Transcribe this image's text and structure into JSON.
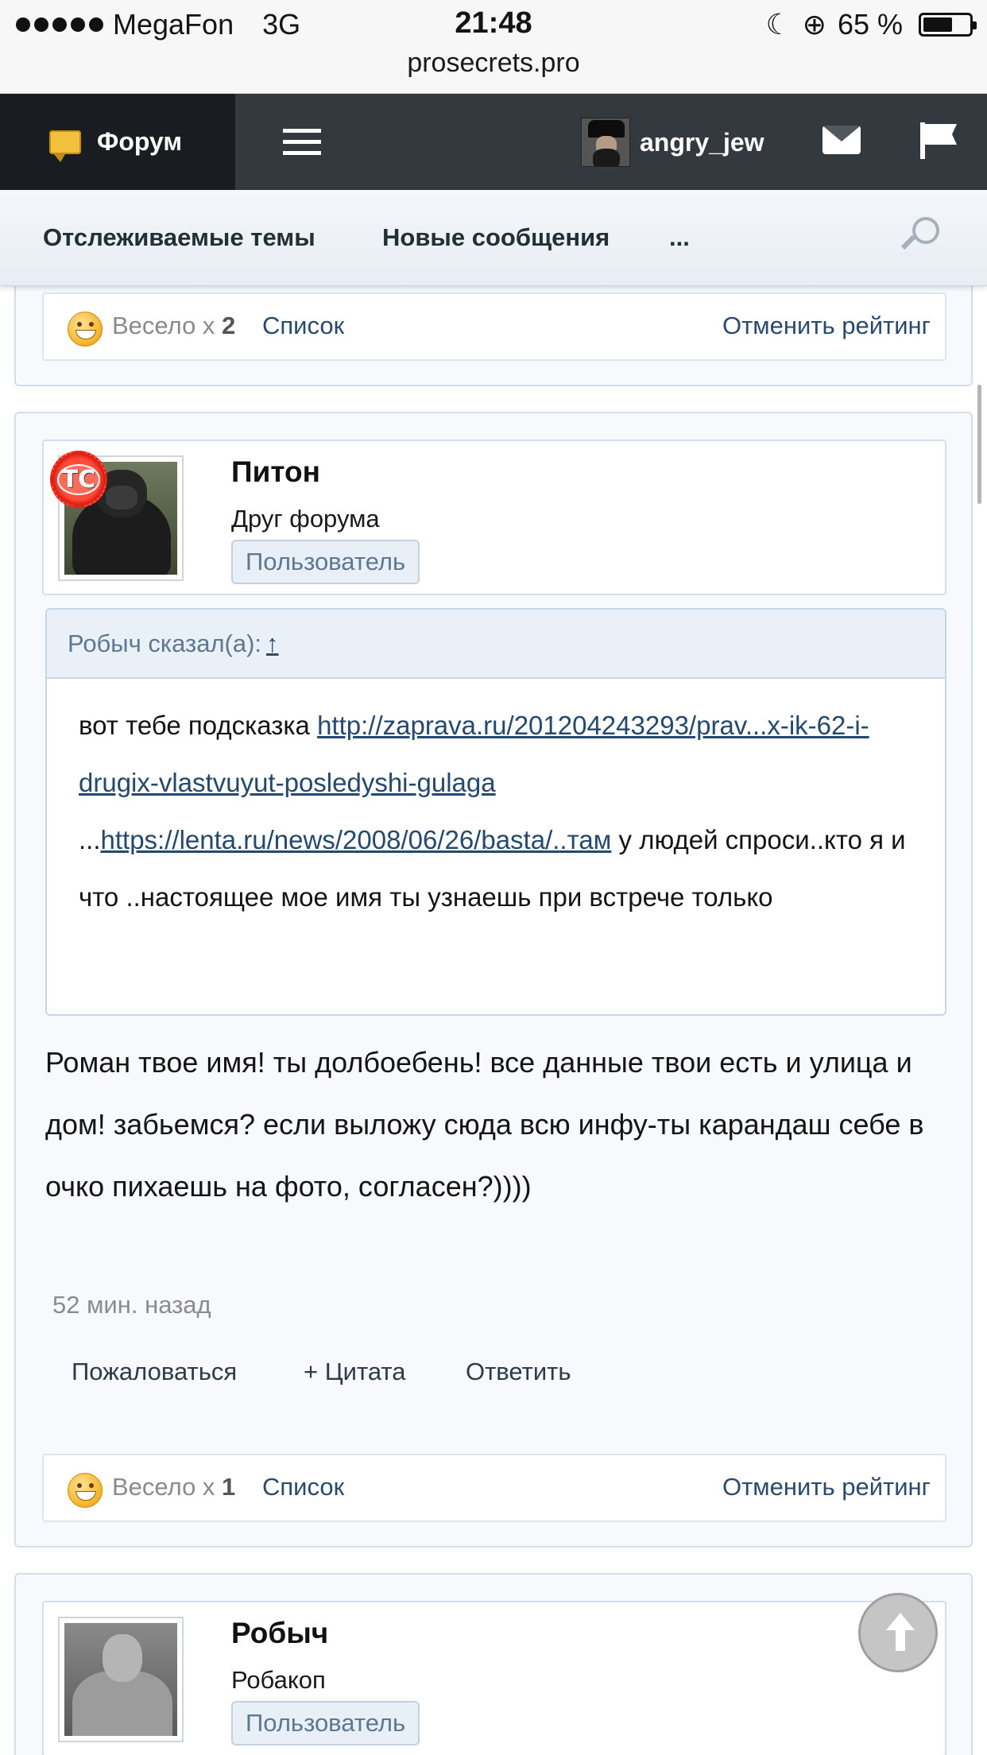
{
  "status_bar": {
    "carrier": "MegaFon",
    "network": "3G",
    "time": "21:48",
    "battery": "65 %",
    "battery_level": 0.65,
    "url": "prosecrets.pro"
  },
  "navbar": {
    "forum_label": "Форум",
    "username": "angry_jew"
  },
  "subnav": {
    "tracked": "Отслеживаемые темы",
    "new_messages": "Новые сообщения",
    "more": "..."
  },
  "rating_prev": {
    "label": "Весело x",
    "count": "2",
    "list": "Список",
    "cancel": "Отменить рейтинг"
  },
  "post": {
    "author": "Питон",
    "author_title": "Друг форума",
    "author_badge": "Пользователь",
    "ts_badge": "TC",
    "quote_header": "Робыч сказал(а):",
    "quote_arrow": "↑",
    "quote_pre": "вот тебе подсказка ",
    "quote_link1": "http://zaprava.ru/201204243293/prav...x-ik-62-i-drugix-vlastvuyut-posledyshi-gulaga",
    "quote_mid": "...",
    "quote_link2": "https://lenta.ru/news/2008/06/26/basta/..там",
    "quote_post": " у людей спроси..кто я и что ..настоящее мое имя ты узнаешь при встрече только",
    "text": "Роман твое имя! ты долбоебень! все данные твои есть и улица и дом! забьемся? если выложу сюда всю инфу-ты карандаш себе в очко пихаешь на фото, согласен?))))",
    "time": "52 мин. назад",
    "report": "Пожаловаться",
    "quote_btn": "+ Цитата",
    "reply": "Ответить"
  },
  "rating_post": {
    "label": "Весело x",
    "count": "1",
    "list": "Список",
    "cancel": "Отменить рейтинг"
  },
  "next_post": {
    "author": "Робыч",
    "author_title": "Робакоп",
    "author_badge": "Пользователь"
  }
}
